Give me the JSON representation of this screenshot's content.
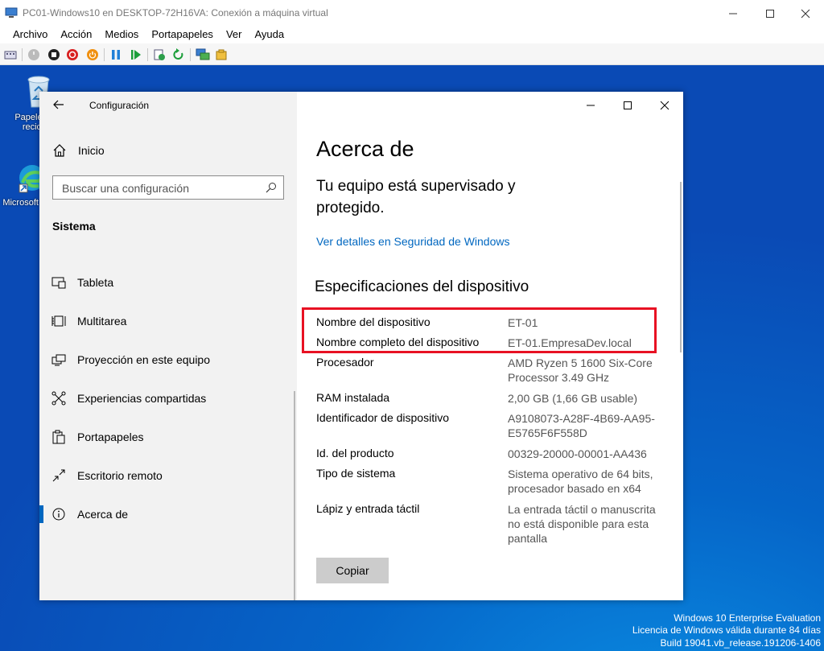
{
  "host": {
    "title": "PC01-Windows10 en DESKTOP-72H16VA: Conexión a máquina virtual",
    "menu": [
      "Archivo",
      "Acción",
      "Medios",
      "Portapapeles",
      "Ver",
      "Ayuda"
    ]
  },
  "desktop": {
    "icons": [
      {
        "label": "Papelera de reciclaje"
      },
      {
        "label": "Microsoft Edge"
      }
    ],
    "watermark": {
      "line1": "Windows 10 Enterprise Evaluation",
      "line2": "Licencia de Windows válida durante 84 días",
      "line3": "Build 19041.vb_release.191206-1406"
    }
  },
  "settings": {
    "app_title": "Configuración",
    "home_label": "Inicio",
    "search_placeholder": "Buscar una configuración",
    "section_title": "Sistema",
    "nav_items": [
      {
        "label": "Tableta",
        "icon": "tablet-icon"
      },
      {
        "label": "Multitarea",
        "icon": "multitask-icon"
      },
      {
        "label": "Proyección en este equipo",
        "icon": "projection-icon"
      },
      {
        "label": "Experiencias compartidas",
        "icon": "shared-icon"
      },
      {
        "label": "Portapapeles",
        "icon": "clipboard-icon"
      },
      {
        "label": "Escritorio remoto",
        "icon": "remote-icon"
      },
      {
        "label": "Acerca de",
        "icon": "info-icon",
        "active": true
      }
    ],
    "page_title": "Acerca de",
    "protected_text": "Tu equipo está supervisado y protegido.",
    "security_link": "Ver detalles en Seguridad de Windows",
    "specs_title": "Especificaciones del dispositivo",
    "specs": [
      {
        "label": "Nombre del dispositivo",
        "value": "ET-01"
      },
      {
        "label": "Nombre completo del dispositivo",
        "value": "ET-01.EmpresaDev.local"
      },
      {
        "label": "Procesador",
        "value": "AMD Ryzen 5 1600 Six-Core Processor 3.49 GHz"
      },
      {
        "label": "RAM instalada",
        "value": "2,00 GB (1,66 GB usable)"
      },
      {
        "label": "Identificador de dispositivo",
        "value": "A9108073-A28F-4B69-AA95-E5765F6F558D"
      },
      {
        "label": "Id. del producto",
        "value": "00329-20000-00001-AA436"
      },
      {
        "label": "Tipo de sistema",
        "value": "Sistema operativo de 64 bits, procesador basado en x64"
      },
      {
        "label": "Lápiz y entrada táctil",
        "value": "La entrada táctil o manuscrita no está disponible para esta pantalla"
      }
    ],
    "copy_button": "Copiar"
  }
}
